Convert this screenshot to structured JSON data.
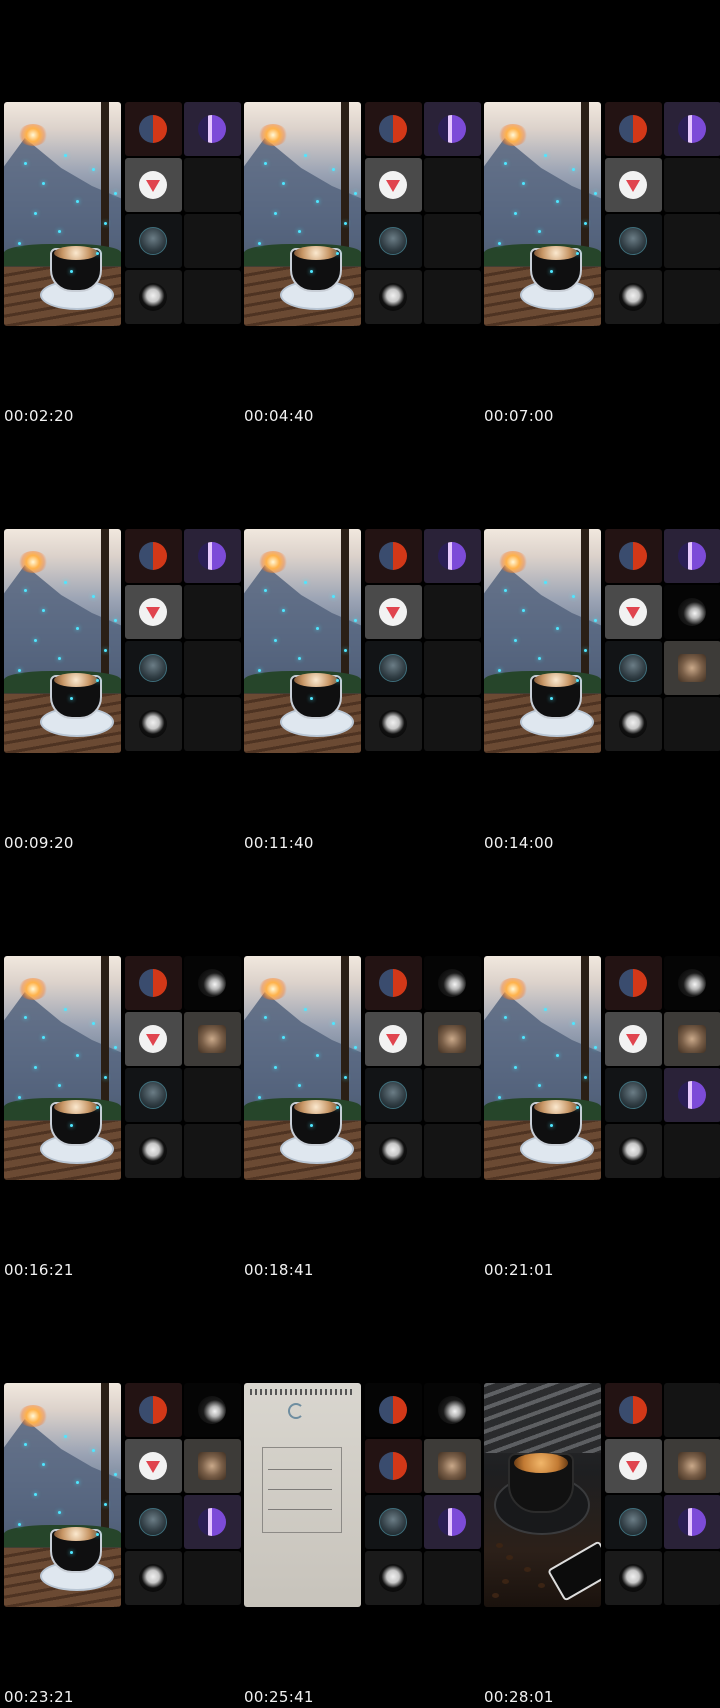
{
  "timestamps": [
    "00:02:20",
    "00:04:40",
    "00:07:00",
    "00:09:20",
    "00:11:40",
    "00:14:00",
    "00:16:21",
    "00:18:41",
    "00:21:01",
    "00:23:21",
    "00:25:41",
    "00:28:01"
  ]
}
